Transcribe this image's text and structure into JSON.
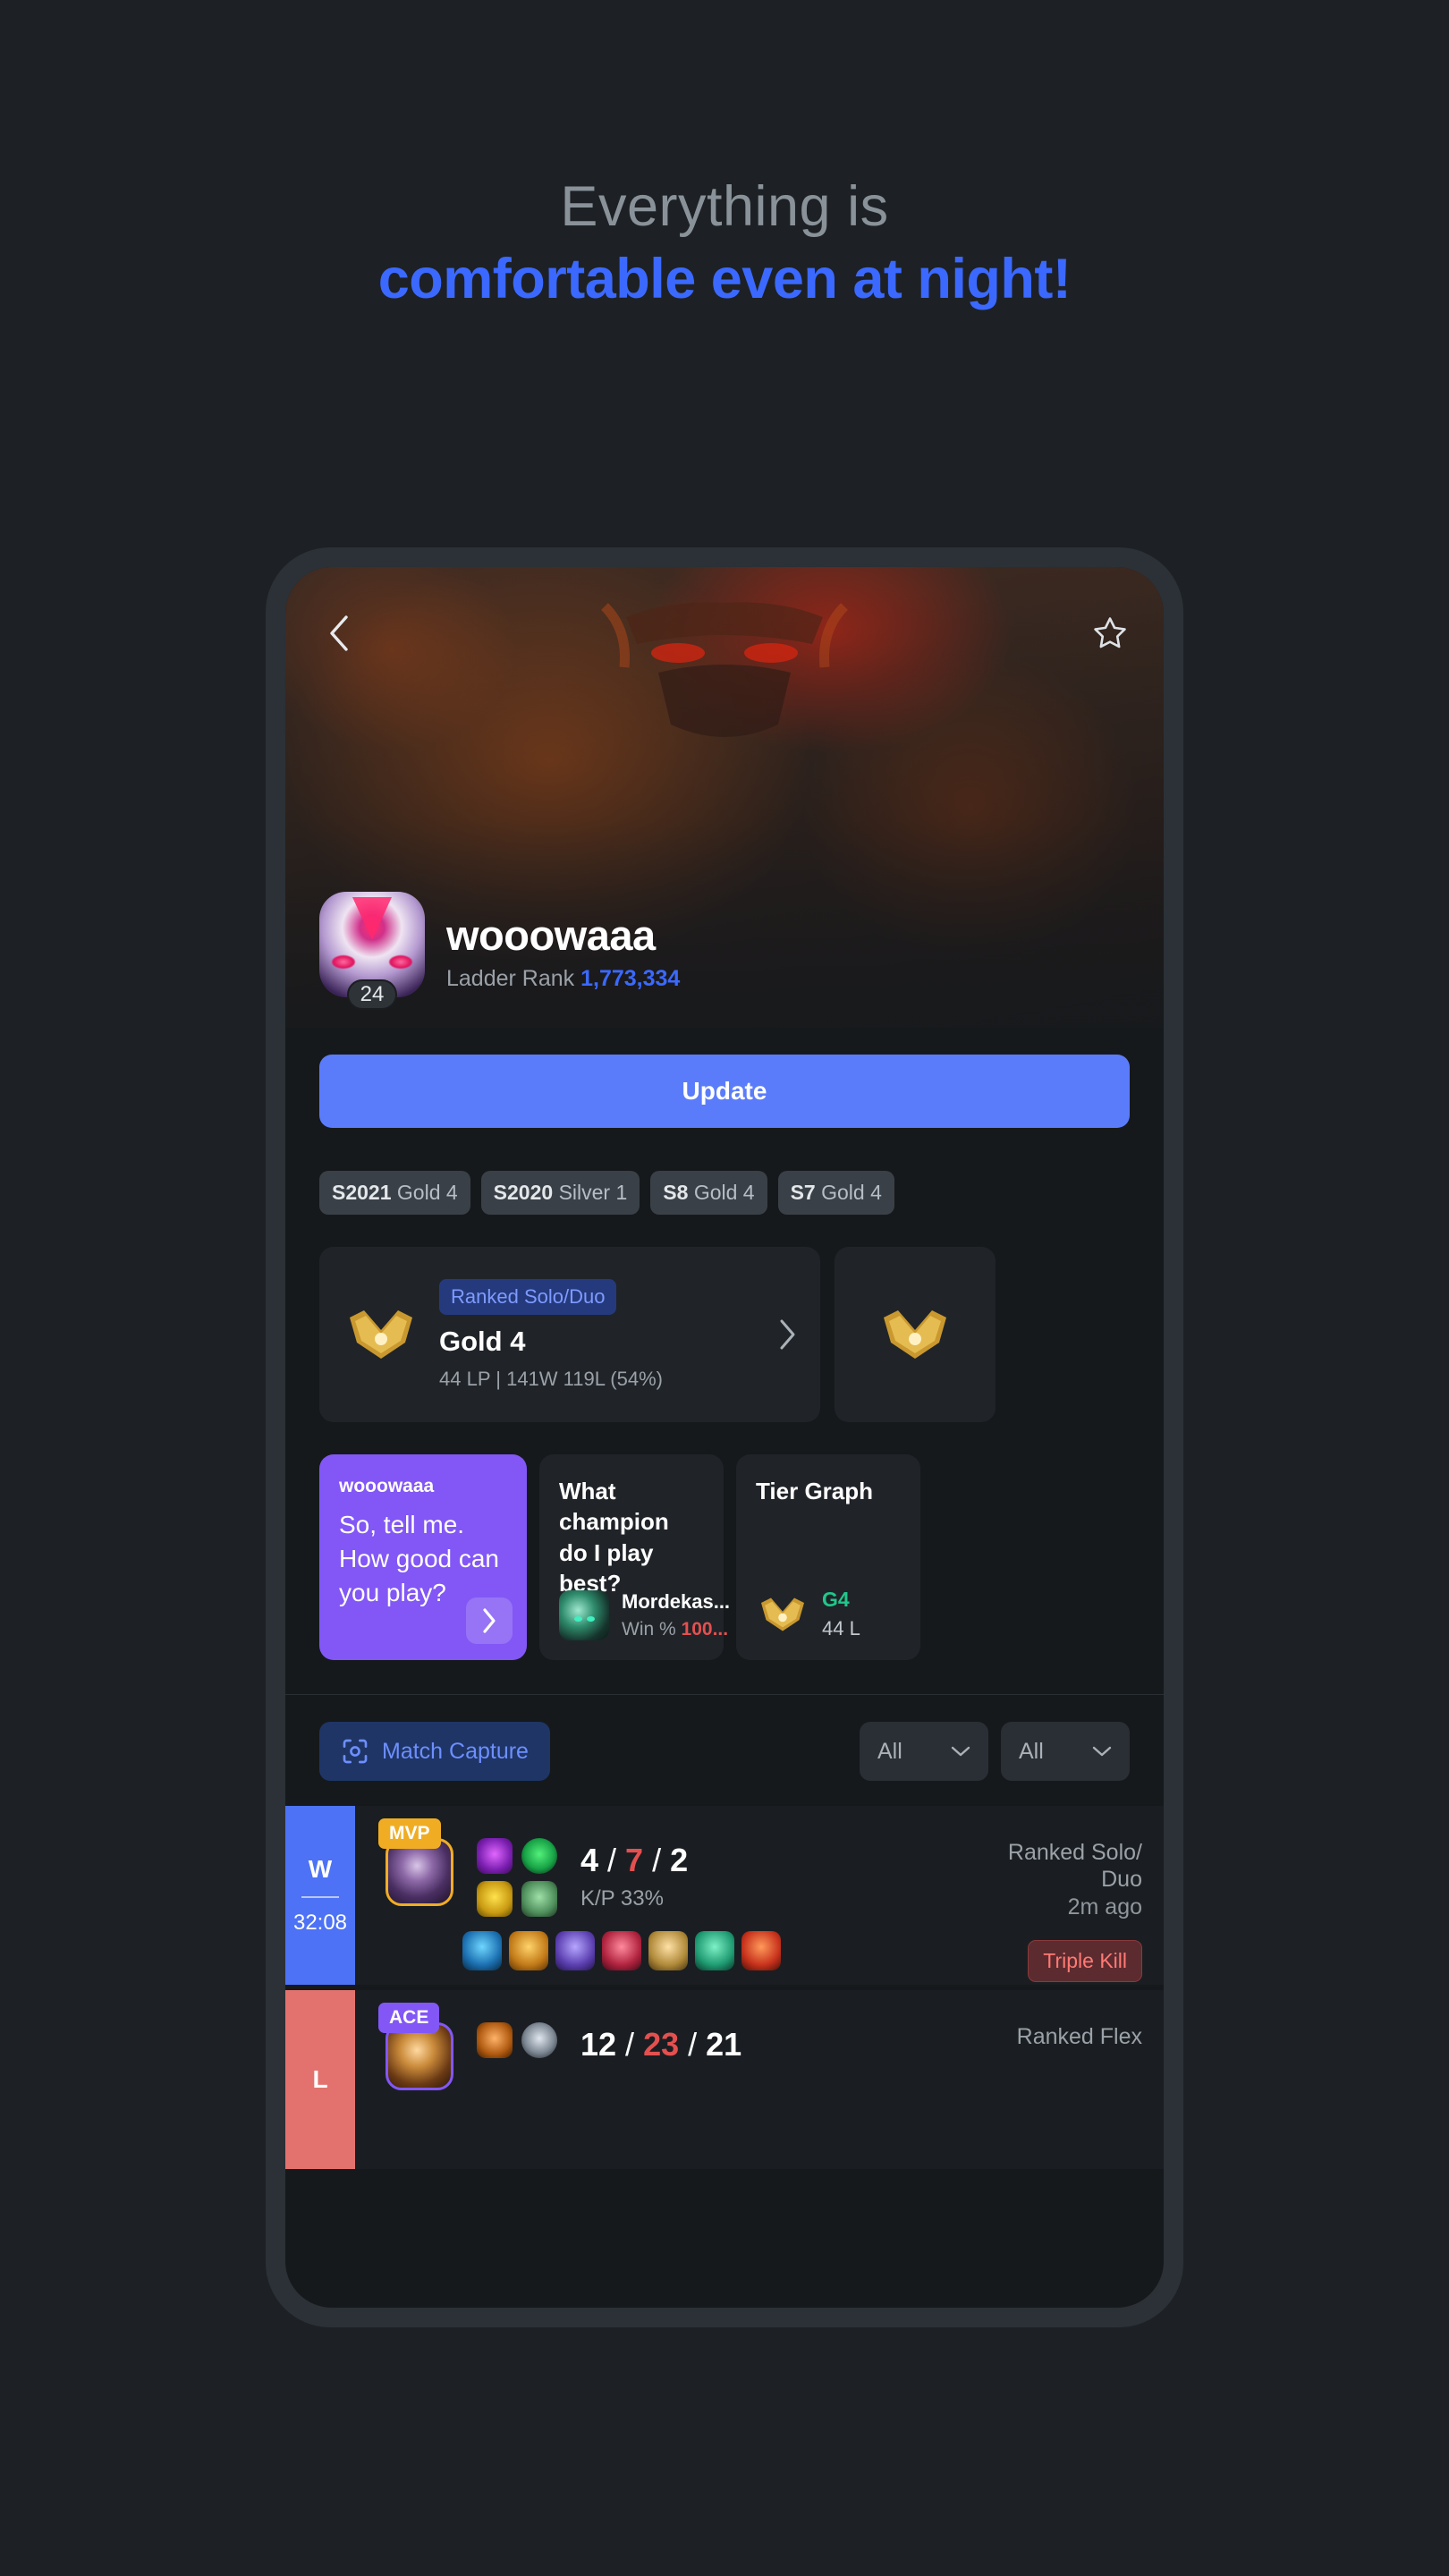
{
  "headline": {
    "line1": "Everything is",
    "line2": "comfortable even at night!",
    "color_muted": "#8a9299",
    "color_accent": "#3b69ff"
  },
  "nav": {
    "back_icon": "chevron-left-icon",
    "favorite_icon": "star-outline-icon"
  },
  "profile": {
    "summoner_name": "wooowaaa",
    "level": "24",
    "ladder_rank_label": "Ladder Rank",
    "ladder_rank_value": "1,773,334",
    "update_button": "Update"
  },
  "season_badges": [
    {
      "season": "S2021",
      "tier": "Gold 4"
    },
    {
      "season": "S2020",
      "tier": "Silver 1"
    },
    {
      "season": "S8",
      "tier": "Gold 4"
    },
    {
      "season": "S7",
      "tier": "Gold 4"
    }
  ],
  "ranked_cards": [
    {
      "queue": "Ranked Solo/Duo",
      "tier": "Gold 4",
      "lp": "44 LP",
      "record": "141W 119L (54%)",
      "separator": "|",
      "chevron_icon": "chevron-right-icon"
    }
  ],
  "ai_cards": {
    "prompt_card": {
      "user": "wooowaaa",
      "question_line1": "So, tell me.",
      "question_line2": "How good can",
      "question_line3": "you play?",
      "arrow_icon": "chevron-right-icon",
      "bg_color": "#8257f5"
    },
    "champion_card": {
      "title_line1": "What champion",
      "title_line2": "do I play best?",
      "champion": "Mordekas...",
      "winrate_label": "Win %",
      "winrate_value": "100..."
    },
    "tier_graph_card": {
      "title": "Tier Graph",
      "tier_short": "G4",
      "lp": "44 L"
    }
  },
  "filters": {
    "match_capture_label": "Match Capture",
    "capture_icon": "focus-capture-icon",
    "select_left": "All",
    "select_right": "All",
    "chevron_icon": "chevron-down-icon"
  },
  "matches": [
    {
      "result": "W",
      "duration": "32:08",
      "badge": "MVP",
      "kills": "4",
      "deaths": "7",
      "assists": "2",
      "kp": "K/P 33%",
      "queue_line1": "Ranked Solo/",
      "queue_line2": "Duo",
      "time_ago": "2m ago",
      "multikill": "Triple Kill"
    },
    {
      "result": "L",
      "duration": "",
      "badge": "ACE",
      "kills": "12",
      "deaths": "23",
      "assists": "21",
      "kp": "",
      "queue_line1": "Ranked Flex",
      "queue_line2": "",
      "time_ago": "",
      "multikill": ""
    }
  ]
}
